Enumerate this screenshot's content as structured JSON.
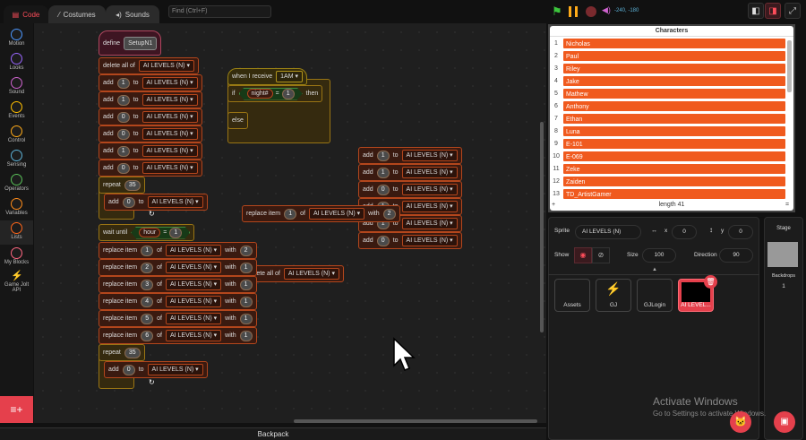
{
  "tabs": [
    {
      "label": "Code",
      "icon": "code-icon"
    },
    {
      "label": "Costumes",
      "icon": "brush-icon"
    },
    {
      "label": "Sounds",
      "icon": "speaker-icon"
    }
  ],
  "search": {
    "placeholder": "Find (Ctrl+F)"
  },
  "categories": [
    {
      "label": "Motion",
      "color": "#4c97ff"
    },
    {
      "label": "Looks",
      "color": "#9966ff"
    },
    {
      "label": "Sound",
      "color": "#cf63cf"
    },
    {
      "label": "Events",
      "color": "#ffbf00"
    },
    {
      "label": "Control",
      "color": "#ffab19"
    },
    {
      "label": "Sensing",
      "color": "#5cb1d6"
    },
    {
      "label": "Operators",
      "color": "#59c059"
    },
    {
      "label": "Variables",
      "color": "#ff8c1a"
    },
    {
      "label": "Lists",
      "color": "#ff661a",
      "selected": true
    },
    {
      "label": "My Blocks",
      "color": "#ff6680"
    },
    {
      "label": "Game Jolt API",
      "color": "#ffffff",
      "icon": "game-jolt-icon"
    }
  ],
  "blocks": [
    {
      "cat": "def",
      "parts": [
        [
          "t",
          "define"
        ],
        [
          "p",
          "SetupN1"
        ]
      ]
    },
    {
      "cat": "list",
      "parts": [
        [
          "t",
          "delete all of"
        ],
        [
          "d",
          "AI LEVELS (N)"
        ]
      ]
    },
    {
      "cat": "list",
      "parts": [
        [
          "t",
          "add"
        ],
        [
          "n",
          "1"
        ],
        [
          "t",
          "to"
        ],
        [
          "d",
          "AI LEVELS (N)"
        ]
      ]
    },
    {
      "cat": "list",
      "parts": [
        [
          "t",
          "add"
        ],
        [
          "n",
          "1"
        ],
        [
          "t",
          "to"
        ],
        [
          "d",
          "AI LEVELS (N)"
        ]
      ]
    },
    {
      "cat": "list",
      "parts": [
        [
          "t",
          "add"
        ],
        [
          "n",
          "0"
        ],
        [
          "t",
          "to"
        ],
        [
          "d",
          "AI LEVELS (N)"
        ]
      ]
    },
    {
      "cat": "list",
      "parts": [
        [
          "t",
          "add"
        ],
        [
          "n",
          "0"
        ],
        [
          "t",
          "to"
        ],
        [
          "d",
          "AI LEVELS (N)"
        ]
      ]
    },
    {
      "cat": "list",
      "parts": [
        [
          "t",
          "add"
        ],
        [
          "n",
          "1"
        ],
        [
          "t",
          "to"
        ],
        [
          "d",
          "AI LEVELS (N)"
        ]
      ]
    },
    {
      "cat": "list",
      "parts": [
        [
          "t",
          "add"
        ],
        [
          "n",
          "0"
        ],
        [
          "t",
          "to"
        ],
        [
          "d",
          "AI LEVELS (N)"
        ]
      ]
    },
    {
      "cat": "ctl",
      "parts": [
        [
          "t",
          "repeat"
        ],
        [
          "n",
          "35"
        ]
      ]
    },
    {
      "cat": "list",
      "parts": [
        [
          "t",
          "add"
        ],
        [
          "n",
          "0"
        ],
        [
          "t",
          "to"
        ],
        [
          "d",
          "AI LEVELS (N)"
        ]
      ]
    },
    {
      "cat": "ctl",
      "parts": [
        [
          "t",
          "wait until"
        ],
        [
          "c",
          "hour",
          "=",
          "1"
        ]
      ]
    },
    {
      "cat": "list",
      "parts": [
        [
          "t",
          "replace item"
        ],
        [
          "n",
          "1"
        ],
        [
          "t",
          "of"
        ],
        [
          "d",
          "AI LEVELS (N)"
        ],
        [
          "t",
          "with"
        ],
        [
          "n",
          "2"
        ]
      ]
    },
    {
      "cat": "list",
      "parts": [
        [
          "t",
          "replace item"
        ],
        [
          "n",
          "2"
        ],
        [
          "t",
          "of"
        ],
        [
          "d",
          "AI LEVELS (N)"
        ],
        [
          "t",
          "with"
        ],
        [
          "n",
          "1"
        ]
      ]
    },
    {
      "cat": "list",
      "parts": [
        [
          "t",
          "replace item"
        ],
        [
          "n",
          "3"
        ],
        [
          "t",
          "of"
        ],
        [
          "d",
          "AI LEVELS (N)"
        ],
        [
          "t",
          "with"
        ],
        [
          "n",
          "1"
        ]
      ]
    },
    {
      "cat": "list",
      "parts": [
        [
          "t",
          "replace item"
        ],
        [
          "n",
          "4"
        ],
        [
          "t",
          "of"
        ],
        [
          "d",
          "AI LEVELS (N)"
        ],
        [
          "t",
          "with"
        ],
        [
          "n",
          "1"
        ]
      ]
    },
    {
      "cat": "list",
      "parts": [
        [
          "t",
          "replace item"
        ],
        [
          "n",
          "5"
        ],
        [
          "t",
          "of"
        ],
        [
          "d",
          "AI LEVELS (N)"
        ],
        [
          "t",
          "with"
        ],
        [
          "n",
          "1"
        ]
      ]
    },
    {
      "cat": "list",
      "parts": [
        [
          "t",
          "replace item"
        ],
        [
          "n",
          "6"
        ],
        [
          "t",
          "of"
        ],
        [
          "d",
          "AI LEVELS (N)"
        ],
        [
          "t",
          "with"
        ],
        [
          "n",
          "1"
        ]
      ]
    },
    {
      "cat": "ctl",
      "parts": [
        [
          "t",
          "repeat"
        ],
        [
          "n",
          "35"
        ]
      ]
    },
    {
      "cat": "list",
      "parts": [
        [
          "t",
          "add"
        ],
        [
          "n",
          "0"
        ],
        [
          "t",
          "to"
        ],
        [
          "d",
          "AI LEVELS (N)"
        ]
      ]
    },
    {
      "cat": "evt",
      "parts": [
        [
          "t",
          "when I receive"
        ],
        [
          "d",
          "1AM"
        ]
      ]
    },
    {
      "cat": "ctl",
      "parts": [
        [
          "t",
          "if"
        ],
        [
          "c",
          "night#",
          "=",
          "1"
        ],
        [
          "t",
          "then"
        ]
      ]
    },
    {
      "cat": "ctl",
      "parts": [
        [
          "t",
          "else"
        ]
      ]
    },
    {
      "cat": "list",
      "parts": [
        [
          "t",
          "add"
        ],
        [
          "n",
          "1"
        ],
        [
          "t",
          "to"
        ],
        [
          "d",
          "AI LEVELS (N)"
        ]
      ]
    },
    {
      "cat": "list",
      "parts": [
        [
          "t",
          "add"
        ],
        [
          "n",
          "1"
        ],
        [
          "t",
          "to"
        ],
        [
          "d",
          "AI LEVELS (N)"
        ]
      ]
    },
    {
      "cat": "list",
      "parts": [
        [
          "t",
          "add"
        ],
        [
          "n",
          "0"
        ],
        [
          "t",
          "to"
        ],
        [
          "d",
          "AI LEVELS (N)"
        ]
      ]
    },
    {
      "cat": "list",
      "parts": [
        [
          "t",
          "add"
        ],
        [
          "n",
          "1"
        ],
        [
          "t",
          "to"
        ],
        [
          "d",
          "AI LEVELS (N)"
        ]
      ]
    },
    {
      "cat": "list",
      "parts": [
        [
          "t",
          "add"
        ],
        [
          "n",
          "1"
        ],
        [
          "t",
          "to"
        ],
        [
          "d",
          "AI LEVELS (N)"
        ]
      ]
    },
    {
      "cat": "list",
      "parts": [
        [
          "t",
          "add"
        ],
        [
          "n",
          "0"
        ],
        [
          "t",
          "to"
        ],
        [
          "d",
          "AI LEVELS (N)"
        ]
      ]
    },
    {
      "cat": "list",
      "parts": [
        [
          "t",
          "delete all of"
        ],
        [
          "d",
          "AI LEVELS (N)"
        ]
      ]
    },
    {
      "cat": "list",
      "parts": [
        [
          "t",
          "replace item"
        ],
        [
          "n",
          "1"
        ],
        [
          "t",
          "of"
        ],
        [
          "d",
          "AI LEVELS (N)"
        ],
        [
          "t",
          "with"
        ],
        [
          "n",
          "2"
        ]
      ]
    }
  ],
  "controls": {
    "coords": "-240, -180",
    "flag": "green-flag-icon",
    "pause": "pause-icon",
    "stop": "stop-icon",
    "volume": "volume-icon"
  },
  "monitor": {
    "title": "Characters",
    "items": [
      "Nicholas",
      "Paul",
      "Riley",
      "Jake",
      "Mathew",
      "Anthony",
      "Ethan",
      "Luna",
      "E-101",
      "E-069",
      "Zeke",
      "Zaiden",
      "TD_ArtistGamer"
    ],
    "length_label": "length 41",
    "add": "+",
    "resize": "="
  },
  "sprite": {
    "sprite_label": "Sprite",
    "name": "AI LEVELS (N)",
    "x_label": "x",
    "x": "0",
    "y_label": "y",
    "y": "0",
    "show_label": "Show",
    "size_label": "Size",
    "size": "100",
    "direction_label": "Direction",
    "direction": "90"
  },
  "sprites": [
    "Assets",
    "GJ",
    "GJLogin",
    "AI LEVEL..."
  ],
  "stage": {
    "label": "Stage",
    "backdrops_label": "Backdrops",
    "backdrops": "1"
  },
  "watermark": {
    "title": "Activate Windows",
    "subtitle": "Go to Settings to activate Windows."
  },
  "backpack": "Backpack",
  "accent": "#ff4d5a"
}
